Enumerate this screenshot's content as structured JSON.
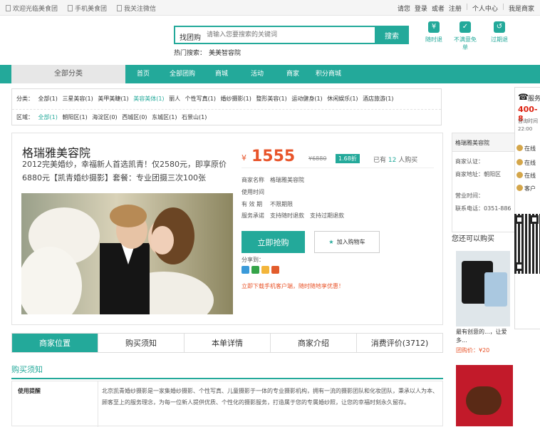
{
  "topbar": {
    "left": [
      "欢迎光临美食团",
      "手机美食团",
      "我关注微信"
    ],
    "right": [
      "请您",
      "登录",
      "或者",
      "注册",
      "个人中心",
      "我是商家"
    ]
  },
  "search": {
    "prefix": "找团购",
    "placeholder": "请输入您要搜索的关键词",
    "button": "搜索",
    "hot_label": "热门搜索：",
    "hot_keywords": [
      "美美智容院"
    ]
  },
  "header_icons": [
    {
      "label": "随时退",
      "icon": "refund-icon"
    },
    {
      "label": "不满意免单",
      "icon": "check-icon"
    },
    {
      "label": "过期退",
      "icon": "expire-icon"
    }
  ],
  "nav": {
    "category_label": "全部分类",
    "items": [
      "首页",
      "全部团购",
      "商城",
      "活动",
      "商家",
      "积分商城"
    ]
  },
  "filter": {
    "row1_label": "分类：",
    "row1": [
      "全部(1)",
      "三星美容(1)",
      "美甲美睫(1)",
      "丽人",
      "美容美体(1)",
      "个性写真(1)",
      "婚纱摄影(1)",
      "整形美容(1)",
      "运动健身(1)",
      "休闲娱乐(1)",
      "酒店旅游(1)"
    ],
    "row1_active": "美容美体(1)",
    "row2_label": "区域：",
    "row2": [
      "全部(1)",
      "朝阳区(1)",
      "海淀区(0)",
      "西城区(0)",
      "东城区(1)",
      "石景山(1)"
    ],
    "row2_active": "全部(1)"
  },
  "product": {
    "title": "格瑞雅美容院",
    "description": "2012完美婚纱，幸福新人首选凯青！仅2580元，即享原价6880元【凯青婚纱摄影】套餐：专业团摄三次100张",
    "currency": "¥",
    "price": "1555",
    "original_price": "¥6880",
    "discount": "1.68折",
    "sold_prefix": "已有",
    "sold_count": "12",
    "sold_suffix": "人购买",
    "info": [
      {
        "label": "商家名称",
        "value": "格瑞雅美容院"
      },
      {
        "label": "使用时间",
        "value": ""
      },
      {
        "label": "有 效 期",
        "value": "不限期限"
      },
      {
        "label": "服务承诺",
        "value": "支持随时退款　支持过期退款"
      }
    ],
    "buy_label": "立即抢购",
    "cart_label": "加入购物车",
    "share_label": "分享到：",
    "share_colors": [
      "#3b9ad9",
      "#35a449",
      "#f3b53b",
      "#e25c2c"
    ],
    "promo_text": "立即下载手机客户端，随时随地享优惠！"
  },
  "tabs": [
    "商家位置",
    "购买须知",
    "本单详情",
    "商家介绍",
    "消费评价(3712)"
  ],
  "tabs_active": 0,
  "notes": {
    "title": "购买须知",
    "label": "使用提醒",
    "text": "北京凯青婚纱摄影是一家集婚纱摄影、个性写真、儿童摄影于一体的专业摄影机构，拥有一流的摄影团队和化妆团队，秉承以人为本、顾客至上的服务理念，为每一位新人提供优质、个性化的摄影服务，打造属于您的专属婚纱照，让您的幸福时刻永久留存。"
  },
  "side": {
    "merchant_title": "格瑞雅美容院",
    "merchant_lines": [
      "商家认证：",
      "商家地址：朝阳区",
      "营业时间：",
      "联系电话：0351-886"
    ],
    "area_title": "您还可以购买",
    "prod1_text": "最有创意的...，让爱多...",
    "prod1_price": "团购价：¥20"
  },
  "float": {
    "title": "服务",
    "phone": "400-8",
    "hours": [
      "咨询时间",
      "22:00"
    ],
    "services": [
      "在线",
      "在线",
      "在线",
      "客户"
    ]
  }
}
